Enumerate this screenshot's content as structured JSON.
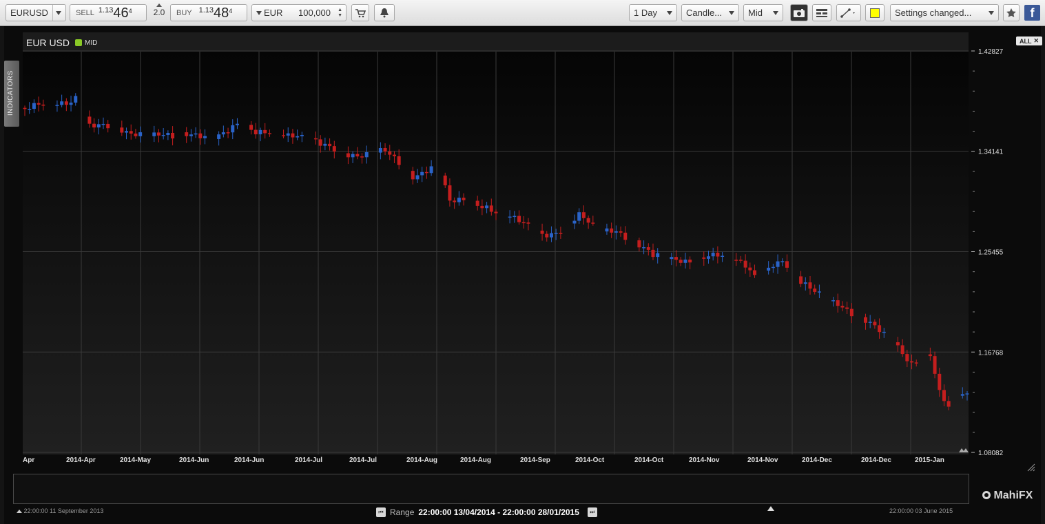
{
  "toolbar": {
    "instrument": "EURUSD",
    "sell_label": "SELL",
    "sell_prefix": "1.13",
    "sell_big": "46",
    "sell_pip": "4",
    "spread": "2.0",
    "buy_label": "BUY",
    "buy_prefix": "1.13",
    "buy_big": "48",
    "buy_pip": "4",
    "currency": "EUR",
    "amount": "100,000",
    "interval": "1 Day",
    "chart_type": "Candle...",
    "price_type": "Mid",
    "settings": "Settings changed...",
    "indicator_color": "#ffff00"
  },
  "chart": {
    "symbol": "EUR USD",
    "price_mode": "MID",
    "mode_color": "#8ac926",
    "indicators_tab": "INDICATORS",
    "all_button": "ALL",
    "up_color": "#2a63c8",
    "down_color": "#c41e1e"
  },
  "chart_data": {
    "type": "candlestick",
    "y_ticks": [
      "1.42827",
      "1.34141",
      "1.25455",
      "1.16768",
      "1.08082"
    ],
    "x_labels": [
      "Apr",
      "2014-Apr",
      "2014-May",
      "2014-Jun",
      "2014-Jun",
      "2014-Jul",
      "2014-Jul",
      "2014-Aug",
      "2014-Aug",
      "2014-Sep",
      "2014-Oct",
      "2014-Oct",
      "2014-Nov",
      "2014-Nov",
      "2014-Dec",
      "2014-Dec",
      "2015-Jan"
    ],
    "ylim": [
      1.08082,
      1.42827
    ],
    "grid": true,
    "close_points": [
      [
        0,
        1.378
      ],
      [
        6,
        1.38
      ],
      [
        10,
        1.387
      ],
      [
        11,
        1.391
      ],
      [
        14,
        1.365
      ],
      [
        18,
        1.36
      ],
      [
        22,
        1.357
      ],
      [
        26,
        1.36
      ],
      [
        30,
        1.356
      ],
      [
        32,
        1.351
      ],
      [
        38,
        1.356
      ],
      [
        42,
        1.358
      ],
      [
        46,
        1.363
      ],
      [
        50,
        1.355
      ],
      [
        54,
        1.361
      ],
      [
        58,
        1.357
      ],
      [
        62,
        1.349
      ],
      [
        64,
        1.345
      ],
      [
        68,
        1.343
      ],
      [
        72,
        1.34
      ],
      [
        74,
        1.339
      ],
      [
        78,
        1.339
      ],
      [
        80,
        1.333
      ],
      [
        84,
        1.322
      ],
      [
        88,
        1.329
      ],
      [
        90,
        1.321
      ],
      [
        92,
        1.295
      ],
      [
        96,
        1.298
      ],
      [
        100,
        1.296
      ],
      [
        104,
        1.286
      ],
      [
        108,
        1.276
      ],
      [
        112,
        1.27
      ],
      [
        116,
        1.275
      ],
      [
        120,
        1.285
      ],
      [
        124,
        1.27
      ],
      [
        128,
        1.275
      ],
      [
        132,
        1.265
      ],
      [
        136,
        1.249
      ],
      [
        140,
        1.247
      ],
      [
        144,
        1.249
      ],
      [
        148,
        1.252
      ],
      [
        152,
        1.247
      ],
      [
        156,
        1.243
      ],
      [
        158,
        1.236
      ],
      [
        162,
        1.245
      ],
      [
        164,
        1.245
      ],
      [
        168,
        1.225
      ],
      [
        172,
        1.22
      ],
      [
        176,
        1.212
      ],
      [
        180,
        1.195
      ],
      [
        184,
        1.188
      ],
      [
        188,
        1.181
      ],
      [
        192,
        1.158
      ],
      [
        196,
        1.162
      ],
      [
        198,
        1.13
      ],
      [
        200,
        1.12
      ],
      [
        202,
        1.134
      ]
    ]
  },
  "navigator": {
    "start_label": "22:00:00 11 September 2013",
    "end_label": "22:00:00 03 June 2015",
    "range_prefix": "Range",
    "range_value": "22:00:00 13/04/2014 - 22:00:00 28/01/2015",
    "brand": "MahiFX",
    "selected_color": "#8fce2a"
  }
}
